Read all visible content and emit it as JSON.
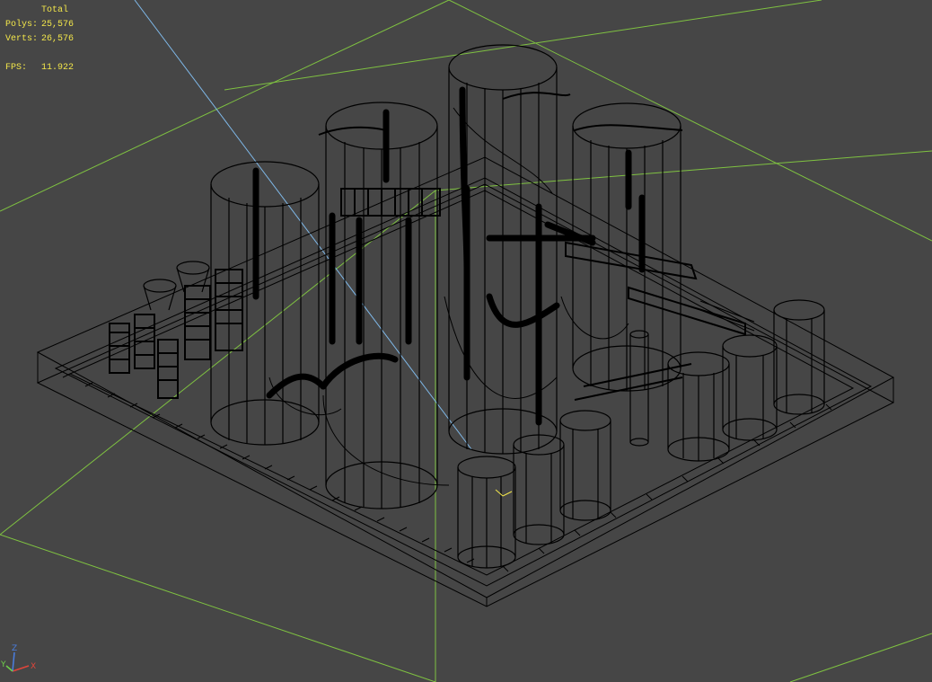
{
  "viewport": {
    "background": "#464646",
    "grid_color": "#7fc241",
    "wire_color": "#000000",
    "view_axis_color": "#7fb8e8"
  },
  "stats": {
    "title": "Total",
    "polys_label": "Polys:",
    "polys_value": "25,576",
    "verts_label": "Verts:",
    "verts_value": "26,576",
    "fps_label": "FPS:",
    "fps_value": "11.922",
    "text_color": "#f2e64a"
  },
  "gizmo": {
    "x_label": "X",
    "y_label": "Y",
    "z_label": "Z",
    "x_color": "#e0453a",
    "y_color": "#6ed04a",
    "z_color": "#4a7ee0"
  }
}
